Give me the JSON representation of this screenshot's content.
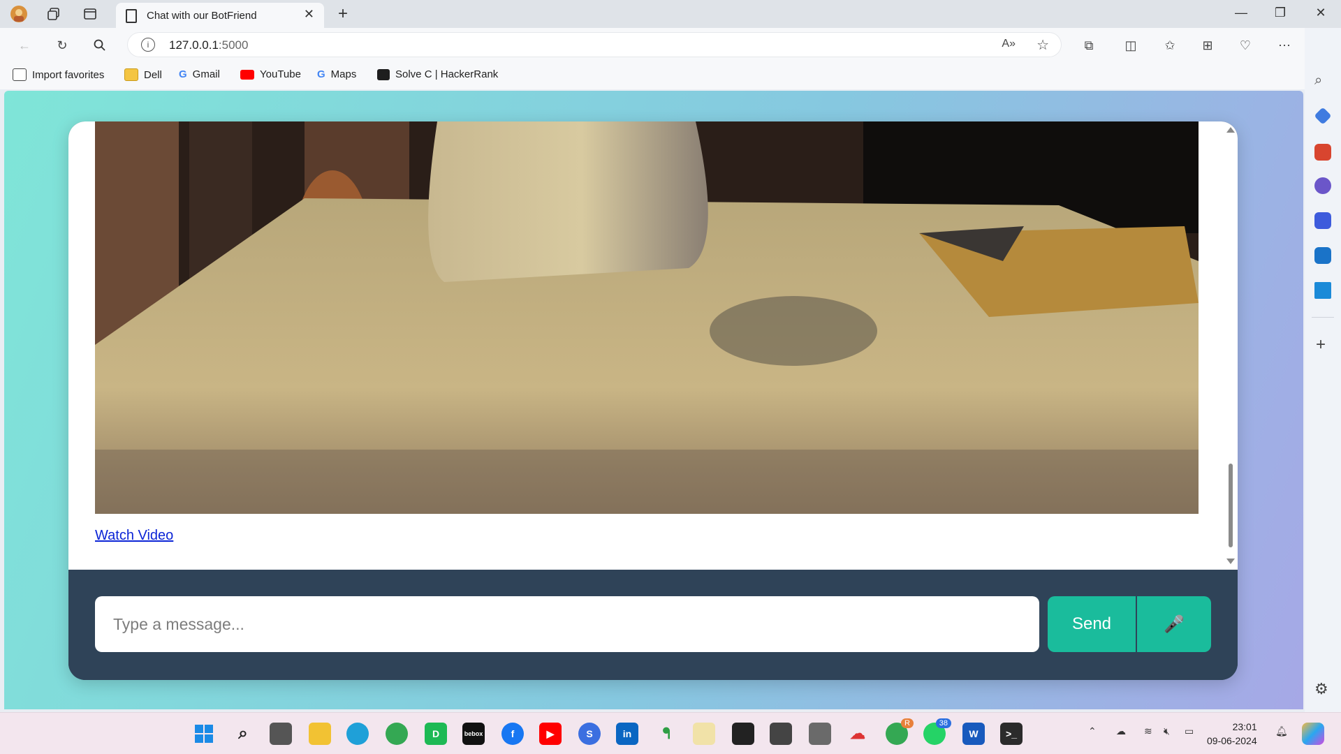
{
  "browser": {
    "tab": {
      "title": "Chat with our BotFriend"
    },
    "address": {
      "host": "127.0.0.1",
      "port": ":5000"
    },
    "bookmarks": [
      {
        "label": "Import favorites",
        "icon": "import-icon"
      },
      {
        "label": "Dell",
        "icon": "folder-icon"
      },
      {
        "label": "Gmail",
        "icon": "google-icon"
      },
      {
        "label": "YouTube",
        "icon": "youtube-icon"
      },
      {
        "label": "Maps",
        "icon": "google-icon"
      },
      {
        "label": "Solve C | HackerRank",
        "icon": "hackerrank-icon"
      }
    ]
  },
  "chat": {
    "watch_video_label": "Watch Video",
    "input_placeholder": "Type a message...",
    "send_label": "Send",
    "mic_icon": "🎤"
  },
  "taskbar": {
    "whatsapp_badge": "38",
    "chrome_badge": "R",
    "time": "23:01",
    "date": "09-06-2024"
  },
  "colors": {
    "accent": "#1abc9c",
    "composer_bg": "#2f4358",
    "link": "#0b24d6"
  }
}
